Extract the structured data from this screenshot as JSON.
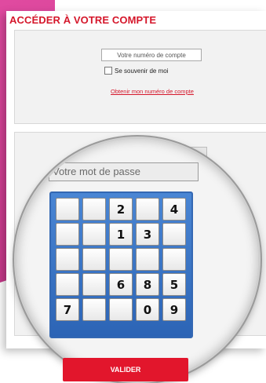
{
  "title": "ACCÉDER À VOTRE COMPTE",
  "account": {
    "placeholder": "Votre numéro de compte",
    "remember_label": "Se souvenir de moi",
    "link_label": "Obtenir mon numéro de compte"
  },
  "password": {
    "placeholder": "Votre mot de passe"
  },
  "keypad": {
    "keys": [
      "",
      "",
      "2",
      "",
      "4",
      "",
      "",
      "1",
      "3",
      "",
      "",
      "",
      "",
      "",
      "",
      "",
      "",
      "6",
      "8",
      "5",
      "7",
      "",
      "",
      "0",
      "9"
    ]
  },
  "submit_label": "VALIDER",
  "colors": {
    "accent": "#d5172b",
    "keypad_blue": "#3468b3",
    "backdrop_pink": "#c7388a"
  }
}
